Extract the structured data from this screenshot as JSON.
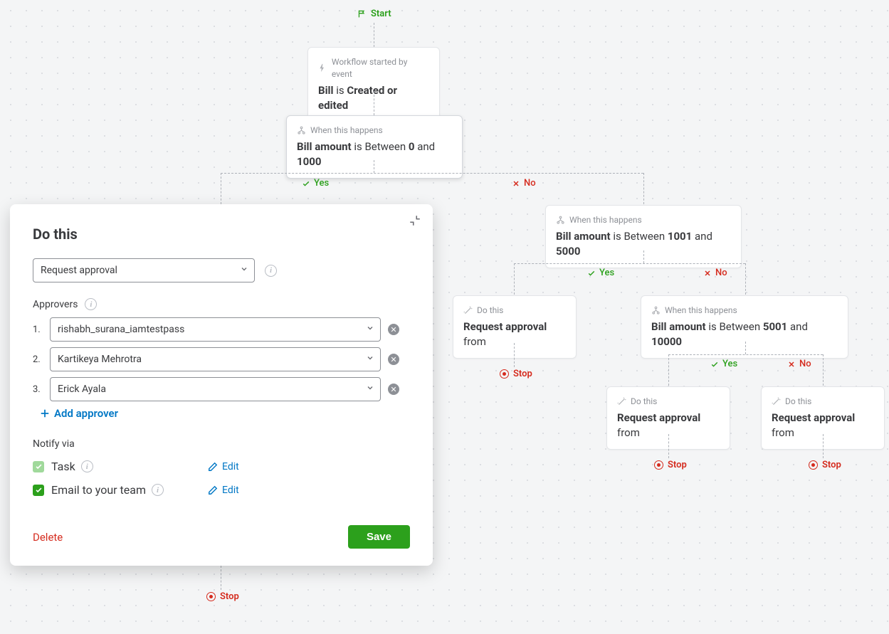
{
  "start_label": "Start",
  "trigger": {
    "overline": "Workflow started by event",
    "subject": "Bill",
    "verb": "is",
    "value": "Created or edited"
  },
  "cond1": {
    "overline": "When this happens",
    "subject": "Bill amount",
    "verb": "is Between",
    "min": "0",
    "and": "and",
    "max": "1000"
  },
  "cond2": {
    "overline": "When this happens",
    "subject": "Bill amount",
    "verb": "is Between",
    "min": "1001",
    "and": "and",
    "max": "5000"
  },
  "cond3": {
    "overline": "When this happens",
    "subject": "Bill amount",
    "verb": "is Between",
    "min": "5001",
    "and": "and",
    "max": "10000"
  },
  "action_label": {
    "overline": "Do this",
    "action": "Request approval",
    "suffix": "from"
  },
  "yes": "Yes",
  "no": "No",
  "stop": "Stop",
  "panel": {
    "title": "Do this",
    "action_select": "Request approval",
    "approvers_label": "Approvers",
    "approvers": [
      "rishabh_surana_iamtestpass",
      "Kartikeya Mehrotra",
      "Erick Ayala"
    ],
    "add_approver": "Add approver",
    "notify_label": "Notify via",
    "notify_task": "Task",
    "notify_email": "Email to your team",
    "edit": "Edit",
    "delete": "Delete",
    "save": "Save"
  }
}
